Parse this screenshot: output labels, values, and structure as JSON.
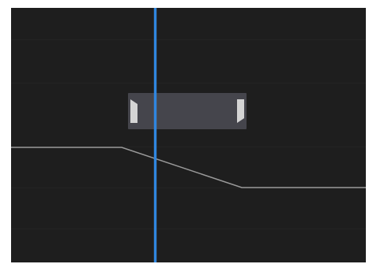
{
  "timeline": {
    "keyframe_selection": {
      "handles": [
        "left-trim-handle",
        "right-trim-handle"
      ]
    },
    "playhead": {
      "color": "#2f86e0"
    },
    "envelope": {
      "color": "#9a9a9a"
    },
    "colors": {
      "background": "#1e1e1e",
      "selection": "#4a4a52",
      "handle": "#e8e8e8"
    }
  }
}
